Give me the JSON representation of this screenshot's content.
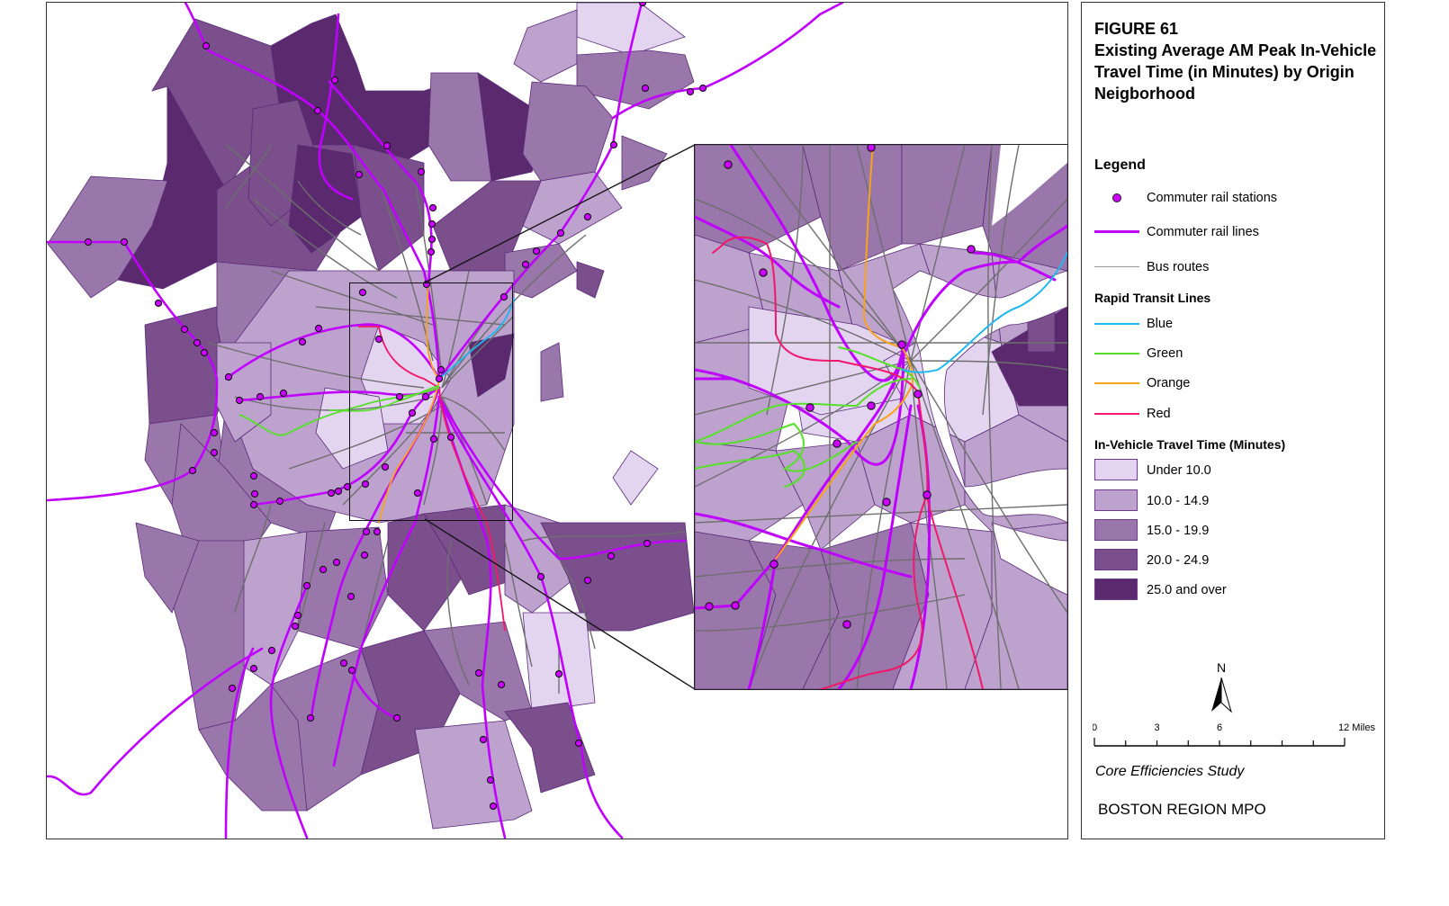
{
  "figure": {
    "number": "FIGURE 61",
    "title": "Existing Average AM Peak In-Vehicle Travel Time (in Minutes) by Origin Neigborhood"
  },
  "legend": {
    "heading": "Legend",
    "items": [
      {
        "label": "Commuter rail stations",
        "symbol": "station-dot",
        "color": "#cc00ff"
      },
      {
        "label": "Commuter rail lines",
        "symbol": "line",
        "color": "#c000ff"
      },
      {
        "label": "Bus routes",
        "symbol": "line",
        "color": "#999999"
      }
    ],
    "rapid_transit": {
      "heading": "Rapid Transit Lines",
      "items": [
        {
          "label": "Blue",
          "color": "#1fb7ee"
        },
        {
          "label": "Green",
          "color": "#55e02a"
        },
        {
          "label": "Orange",
          "color": "#f7a21b"
        },
        {
          "label": "Red",
          "color": "#f0186a"
        }
      ]
    },
    "travel_time": {
      "heading": "In-Vehicle Travel Time (Minutes)",
      "classes": [
        {
          "label": "Under 10.0",
          "color": "#e3d4f0"
        },
        {
          "label": "10.0 - 14.9",
          "color": "#bda2cd"
        },
        {
          "label": "15.0 - 19.9",
          "color": "#9a77ab"
        },
        {
          "label": "20.0 - 24.9",
          "color": "#7a4f8c"
        },
        {
          "label": "25.0 and over",
          "color": "#5b2a6e"
        }
      ]
    }
  },
  "north_arrow": {
    "label": "N"
  },
  "scale_bar": {
    "ticks": [
      "0",
      "3",
      "6",
      "12 Miles"
    ],
    "max_miles": 12
  },
  "credits": {
    "study": "Core Efficiencies Study",
    "organization": "BOSTON REGION MPO"
  },
  "colors": {
    "bus_route": "#6e6e6e",
    "boundary": "#5a2a78",
    "commuter_rail": "#c000ff",
    "station_fill": "#cc00ff"
  }
}
